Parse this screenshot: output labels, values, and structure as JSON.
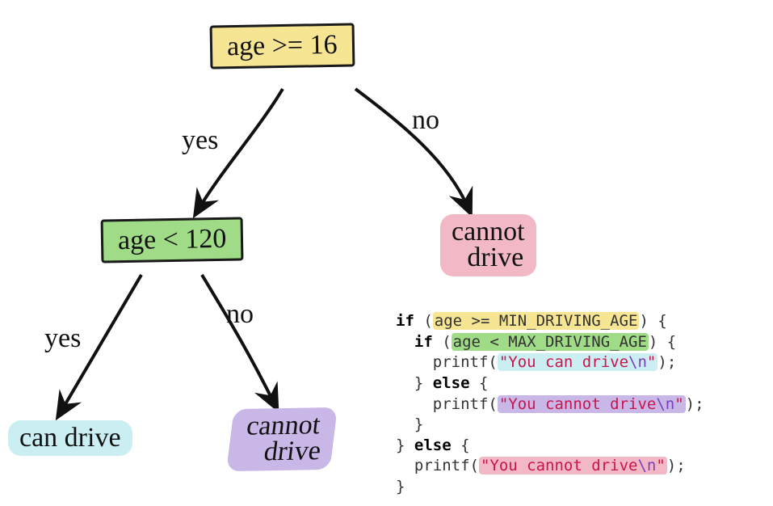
{
  "nodes": {
    "root": {
      "text": "age >= 16"
    },
    "check2": {
      "text": "age < 120"
    }
  },
  "edges": {
    "root_yes": "yes",
    "root_no": "no",
    "check2_yes": "yes",
    "check2_no": "no"
  },
  "leaves": {
    "can_drive": "can drive",
    "cannot_drive_left": {
      "l1": "cannot",
      "l2": "drive"
    },
    "cannot_drive_right": {
      "l1": "cannot",
      "l2": "drive"
    }
  },
  "code": {
    "kw_if": "if",
    "kw_else": "else",
    "cond1": "age >= MIN_DRIVING_AGE",
    "cond2": "age < MAX_DRIVING_AGE",
    "printf": "printf",
    "s_can": "\"You can drive",
    "s_cannot": "\"You cannot drive",
    "nl": "\\n",
    "q": "\"",
    "ob": " {",
    "cb": "}",
    "op": " (",
    "cp": ")",
    "sc": ";"
  }
}
